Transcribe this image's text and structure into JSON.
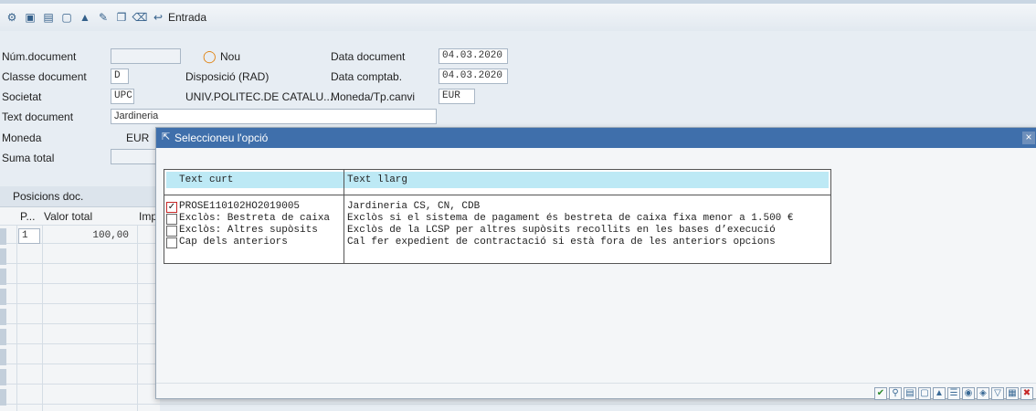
{
  "toolbar": {
    "icons": [
      "hat-icon",
      "save-icon",
      "post-icon",
      "park-icon",
      "hold-icon",
      "edit-icon",
      "copy-icon",
      "delete-icon",
      "enter-icon"
    ],
    "entrada_label": "Entrada"
  },
  "header": {
    "num_document_label": "Núm.document",
    "num_document_value": "",
    "nou_label": "Nou",
    "data_document_label": "Data document",
    "data_document_value": "04.03.2020",
    "classe_document_label": "Classe document",
    "classe_document_value": "D",
    "disposicio_label": "Disposició (RAD)",
    "data_comptab_label": "Data comptab.",
    "data_comptab_value": "04.03.2020",
    "societat_label": "Societat",
    "societat_value": "UPC",
    "societat_name": "UNIV.POLITEC.DE CATALU...",
    "moneda_tp_label": "Moneda/Tp.canvi",
    "moneda_tp_value": "EUR",
    "text_document_label": "Text document",
    "text_document_value": "Jardineria",
    "moneda_label": "Moneda",
    "moneda_value": "EUR",
    "suma_total_label": "Suma total",
    "suma_total_value": ""
  },
  "positions": {
    "title": "Posicions doc.",
    "col_p": "P...",
    "col_valor": "Valor total",
    "col_imp": "Imp",
    "rows": [
      {
        "p": "1",
        "valor": "100,00"
      }
    ]
  },
  "dialog": {
    "title": "Seleccioneu l'opció",
    "col_short": "Text curt",
    "col_long": "Text llarg",
    "options": [
      {
        "checked": true,
        "short": "PROSE110102HO2019005",
        "long": "Jardineria CS, CN, CDB"
      },
      {
        "checked": false,
        "short": "Exclòs: Bestreta de caixa",
        "long": "Exclòs si el sistema de pagament és bestreta de caixa fixa menor a 1.500 €"
      },
      {
        "checked": false,
        "short": "Exclòs: Altres supòsits",
        "long": "Exclòs de la LCSP per altres supòsits recollits en les bases d’execució"
      },
      {
        "checked": false,
        "short": "Cap dels anteriors",
        "long": "Cal fer expedient de contractació si està fora de les anteriors opcions"
      }
    ],
    "footer_buttons": [
      "confirm-icon",
      "find-icon",
      "select-all-icon",
      "deselect-all-icon",
      "sort-asc-icon",
      "filter-icon",
      "search-icon",
      "search-next-icon",
      "filter-funnel-icon",
      "layout-icon",
      "cancel-icon"
    ],
    "close_glyph": "×"
  },
  "colors": {
    "dialog_title_bg": "#3f6fab",
    "list_header_bg": "#bde9f5",
    "app_bg": "#e7edf3"
  }
}
